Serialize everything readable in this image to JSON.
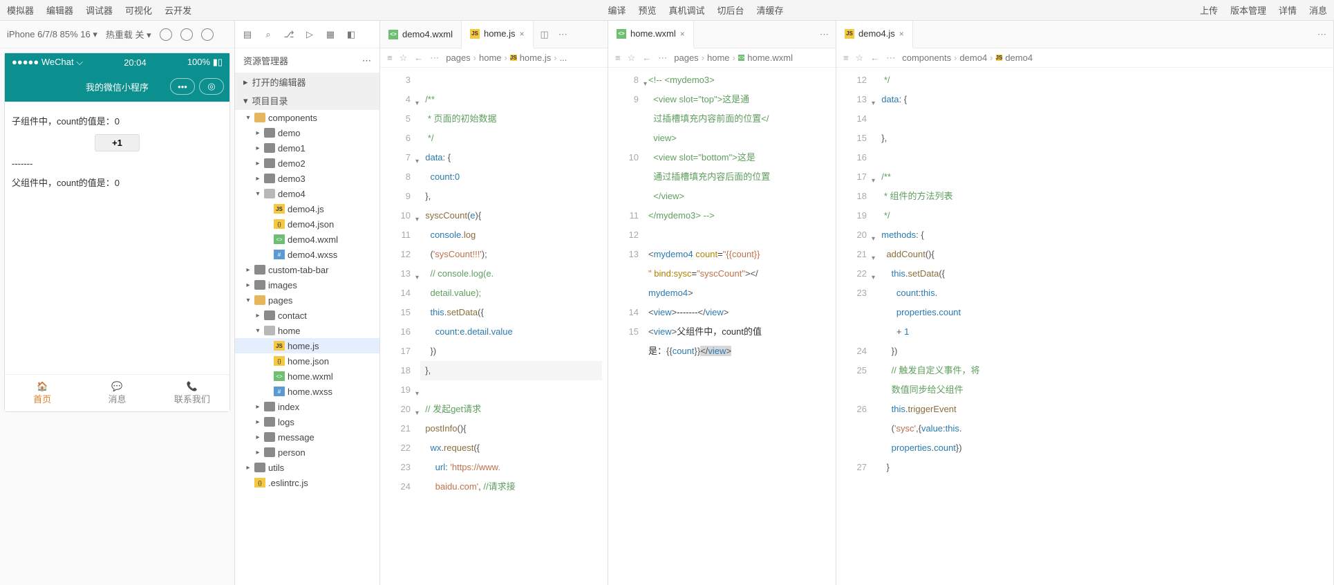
{
  "menus": {
    "left": [
      "模拟器",
      "编辑器",
      "调试器",
      "可视化",
      "云开发"
    ],
    "center": [
      "编译",
      "预览",
      "真机调试",
      "切后台",
      "清缓存"
    ],
    "right": [
      "上传",
      "版本管理",
      "详情",
      "消息"
    ]
  },
  "sim": {
    "device": "iPhone 6/7/8 85% 16 ▾",
    "hotreload": "热重载 关 ▾",
    "statusLeft": "●●●●● WeChat",
    "wifi": "⌃",
    "time": "20:04",
    "battery": "100%",
    "title": "我的微信小程序",
    "line1": "子组件中，count的值是：0",
    "plus": "+1",
    "dash": "-------",
    "line2": "父组件中，count的值是：0",
    "tabs": [
      {
        "label": "首页",
        "active": true
      },
      {
        "label": "消息",
        "active": false
      },
      {
        "label": "联系我们",
        "active": false
      }
    ]
  },
  "explorer": {
    "title": "资源管理器",
    "openEditors": "打开的编辑器",
    "project": "项目目录",
    "tree": [
      {
        "d": 1,
        "arrow": "▾",
        "ic": "folder gold",
        "label": "components"
      },
      {
        "d": 2,
        "arrow": "▸",
        "ic": "folder",
        "label": "demo"
      },
      {
        "d": 2,
        "arrow": "▸",
        "ic": "folder",
        "label": "demo1"
      },
      {
        "d": 2,
        "arrow": "▸",
        "ic": "folder",
        "label": "demo2"
      },
      {
        "d": 2,
        "arrow": "▸",
        "ic": "folder",
        "label": "demo3"
      },
      {
        "d": 2,
        "arrow": "▾",
        "ic": "folder open",
        "label": "demo4"
      },
      {
        "d": 3,
        "arrow": "",
        "ic": "js",
        "label": "demo4.js"
      },
      {
        "d": 3,
        "arrow": "",
        "ic": "json",
        "label": "demo4.json"
      },
      {
        "d": 3,
        "arrow": "",
        "ic": "wxml",
        "label": "demo4.wxml"
      },
      {
        "d": 3,
        "arrow": "",
        "ic": "wxss",
        "label": "demo4.wxss"
      },
      {
        "d": 1,
        "arrow": "▸",
        "ic": "folder",
        "label": "custom-tab-bar"
      },
      {
        "d": 1,
        "arrow": "▸",
        "ic": "folder",
        "label": "images"
      },
      {
        "d": 1,
        "arrow": "▾",
        "ic": "folder gold",
        "label": "pages"
      },
      {
        "d": 2,
        "arrow": "▸",
        "ic": "folder",
        "label": "contact"
      },
      {
        "d": 2,
        "arrow": "▾",
        "ic": "folder open",
        "label": "home"
      },
      {
        "d": 3,
        "arrow": "",
        "ic": "js",
        "label": "home.js",
        "sel": true
      },
      {
        "d": 3,
        "arrow": "",
        "ic": "json",
        "label": "home.json"
      },
      {
        "d": 3,
        "arrow": "",
        "ic": "wxml",
        "label": "home.wxml"
      },
      {
        "d": 3,
        "arrow": "",
        "ic": "wxss",
        "label": "home.wxss"
      },
      {
        "d": 2,
        "arrow": "▸",
        "ic": "folder",
        "label": "index"
      },
      {
        "d": 2,
        "arrow": "▸",
        "ic": "folder",
        "label": "logs"
      },
      {
        "d": 2,
        "arrow": "▸",
        "ic": "folder",
        "label": "message"
      },
      {
        "d": 2,
        "arrow": "▸",
        "ic": "folder",
        "label": "person"
      },
      {
        "d": 1,
        "arrow": "▸",
        "ic": "folder",
        "label": "utils"
      },
      {
        "d": 1,
        "arrow": "",
        "ic": "json",
        "label": ".eslintrc.js"
      }
    ]
  },
  "tabs": {
    "col0": {
      "file": "demo4.wxml",
      "ic": "wxml"
    },
    "col1": {
      "file": "home.js",
      "ic": "js"
    },
    "col2": {
      "file": "home.wxml",
      "ic": "wxml"
    },
    "col3": {
      "file": "demo4.js",
      "ic": "js"
    }
  },
  "crumbs": {
    "col1": [
      "pages",
      "home",
      "home.js",
      "..."
    ],
    "col2": [
      "pages",
      "home",
      "home.wxml"
    ],
    "col3": [
      "components",
      "demo4",
      "demo4"
    ]
  },
  "code1": {
    "start": 3,
    "folds": {
      "4": "▾",
      "7": "▾",
      "10": "▾",
      "13": "▾",
      "19": "▾",
      "20": "▾"
    },
    "lines": [
      "",
      "  <span class='tk-c'>/**</span>",
      "   <span class='tk-c'>* 页面的初始数据</span>",
      "   <span class='tk-c'>*/</span>",
      "  <span class='tk-k'>data</span><span class='tk-p'>:</span> <span class='tk-p'>{</span>",
      "    <span class='tk-k'>count</span><span class='tk-p'>:</span><span class='tk-n'>0</span>",
      "  <span class='tk-p'>},</span>",
      "  <span class='tk-f'>syscCount</span><span class='tk-p'>(</span><span class='tk-k'>e</span><span class='tk-p'>){</span>",
      "    <span class='tk-k'>console</span><span class='tk-p'>.</span><span class='tk-f'>log</span>",
      "    <span class='tk-p'>(</span><span class='tk-s'>'sysCount!!!'</span><span class='tk-p'>);</span>",
      "    <span class='tk-c'>// console.log(e.</span>",
      "    <span class='tk-c'>detail.value);</span>",
      "    <span class='tk-k'>this</span><span class='tk-p'>.</span><span class='tk-f'>setData</span><span class='tk-p'>({</span>",
      "      <span class='tk-k'>count</span><span class='tk-p'>:</span><span class='tk-k'>e</span><span class='tk-p'>.</span><span class='tk-k'>detail</span><span class='tk-p'>.</span><span class='tk-k'>value</span>",
      "    <span class='tk-p'>})</span>",
      "  <span class='tk-p'>},</span>",
      "",
      "  <span class='tk-c'>// 发起get请求</span>",
      "  <span class='tk-f'>postInfo</span><span class='tk-p'>(){</span>",
      "    <span class='tk-k'>wx</span><span class='tk-p'>.</span><span class='tk-f'>request</span><span class='tk-p'>({</span>",
      "      <span class='tk-k'>url</span><span class='tk-p'>:</span> <span class='tk-s'>'https://www.</span>",
      "      <span class='tk-s'>baidu.com'</span><span class='tk-p'>,</span> <span class='tk-c'>//请求接</span>"
    ],
    "hl": 18
  },
  "code2": {
    "start": 8,
    "folds": {
      "8": "▾"
    },
    "lines": [
      "<span class='tk-cmt'>&lt;!-- &lt;mydemo3&gt;</span>",
      "  <span class='tk-cmt'>&lt;view slot=\"top\"&gt;这是通</span>",
      "  <span class='tk-cmt'>过插槽填充内容前面的位置&lt;/</span>",
      "  <span class='tk-cmt'>view&gt;</span>",
      "  <span class='tk-cmt'>&lt;view slot=\"bottom\"&gt;这是</span>",
      "  <span class='tk-cmt'>通过插槽填充内容后面的位置</span>",
      "  <span class='tk-cmt'>&lt;/view&gt;</span>",
      "<span class='tk-cmt'>&lt;/mydemo3&gt; --&gt;</span>",
      "",
      "<span class='tk-p'>&lt;</span><span class='tk-t'>mydemo4</span> <span class='tk-a'>count</span>=<span class='tk-v'>\"{{count}}</span>",
      "<span class='tk-v'>\"</span> <span class='tk-a'>bind:sysc</span>=<span class='tk-v'>\"syscCount\"</span><span class='tk-p'>&gt;&lt;/</span>",
      "<span class='tk-t'>mydemo4</span><span class='tk-p'>&gt;</span>",
      "<span class='tk-p'>&lt;</span><span class='tk-t'>view</span><span class='tk-p'>&gt;</span>-------<span class='tk-p'>&lt;/</span><span class='tk-t'>view</span><span class='tk-p'>&gt;</span>",
      "<span class='tk-p'>&lt;</span><span class='tk-t'>view</span><span class='tk-p'>&gt;</span>父组件中，count的值",
      "是：<span class='tk-p'>{{</span><span class='tk-k'>count</span><span class='tk-p'>}}</span><span class='tk-hl'><span class='tk-p'>&lt;/</span><span class='tk-t'>view</span><span class='tk-p'>&gt;</span></span>"
    ],
    "lnmap": [
      8,
      9,
      "",
      "",
      "10",
      "",
      "",
      "11",
      "12",
      "13",
      "",
      "",
      "14",
      "15",
      ""
    ]
  },
  "code3": {
    "start": 12,
    "folds": {
      "13": "▾",
      "17": "▾",
      "20": "▾",
      "21": "▾",
      "22": "▾"
    },
    "lines": [
      "   <span class='tk-c'>*/</span>",
      "  <span class='tk-k'>data</span><span class='tk-p'>:</span> <span class='tk-p'>{</span>",
      "",
      "  <span class='tk-p'>},</span>",
      "",
      "  <span class='tk-c'>/**</span>",
      "   <span class='tk-c'>* 组件的方法列表</span>",
      "   <span class='tk-c'>*/</span>",
      "  <span class='tk-k'>methods</span><span class='tk-p'>:</span> <span class='tk-p'>{</span>",
      "    <span class='tk-f'>addCount</span><span class='tk-p'>(){</span>",
      "      <span class='tk-k'>this</span><span class='tk-p'>.</span><span class='tk-f'>setData</span><span class='tk-p'>({</span>",
      "        <span class='tk-k'>count</span><span class='tk-p'>:</span><span class='tk-k'>this</span><span class='tk-p'>.</span>",
      "        <span class='tk-k'>properties</span><span class='tk-p'>.</span><span class='tk-k'>count</span>",
      "        <span class='tk-p'>+</span> <span class='tk-n'>1</span>",
      "      <span class='tk-p'>})</span>",
      "      <span class='tk-c'>// 触发自定义事件，将</span>",
      "      <span class='tk-c'>数值同步给父组件</span>",
      "      <span class='tk-k'>this</span><span class='tk-p'>.</span><span class='tk-f'>triggerEvent</span>",
      "      <span class='tk-p'>(</span><span class='tk-s'>'sysc'</span><span class='tk-p'>,{</span><span class='tk-k'>value</span><span class='tk-p'>:</span><span class='tk-k'>this</span><span class='tk-p'>.</span>",
      "      <span class='tk-k'>properties</span><span class='tk-p'>.</span><span class='tk-k'>count</span><span class='tk-p'>})</span>",
      "    <span class='tk-p'>}</span>"
    ],
    "lnmap": [
      12,
      13,
      14,
      15,
      16,
      17,
      18,
      19,
      20,
      21,
      22,
      23,
      "",
      "",
      24,
      25,
      "",
      26,
      "",
      "",
      27
    ]
  }
}
